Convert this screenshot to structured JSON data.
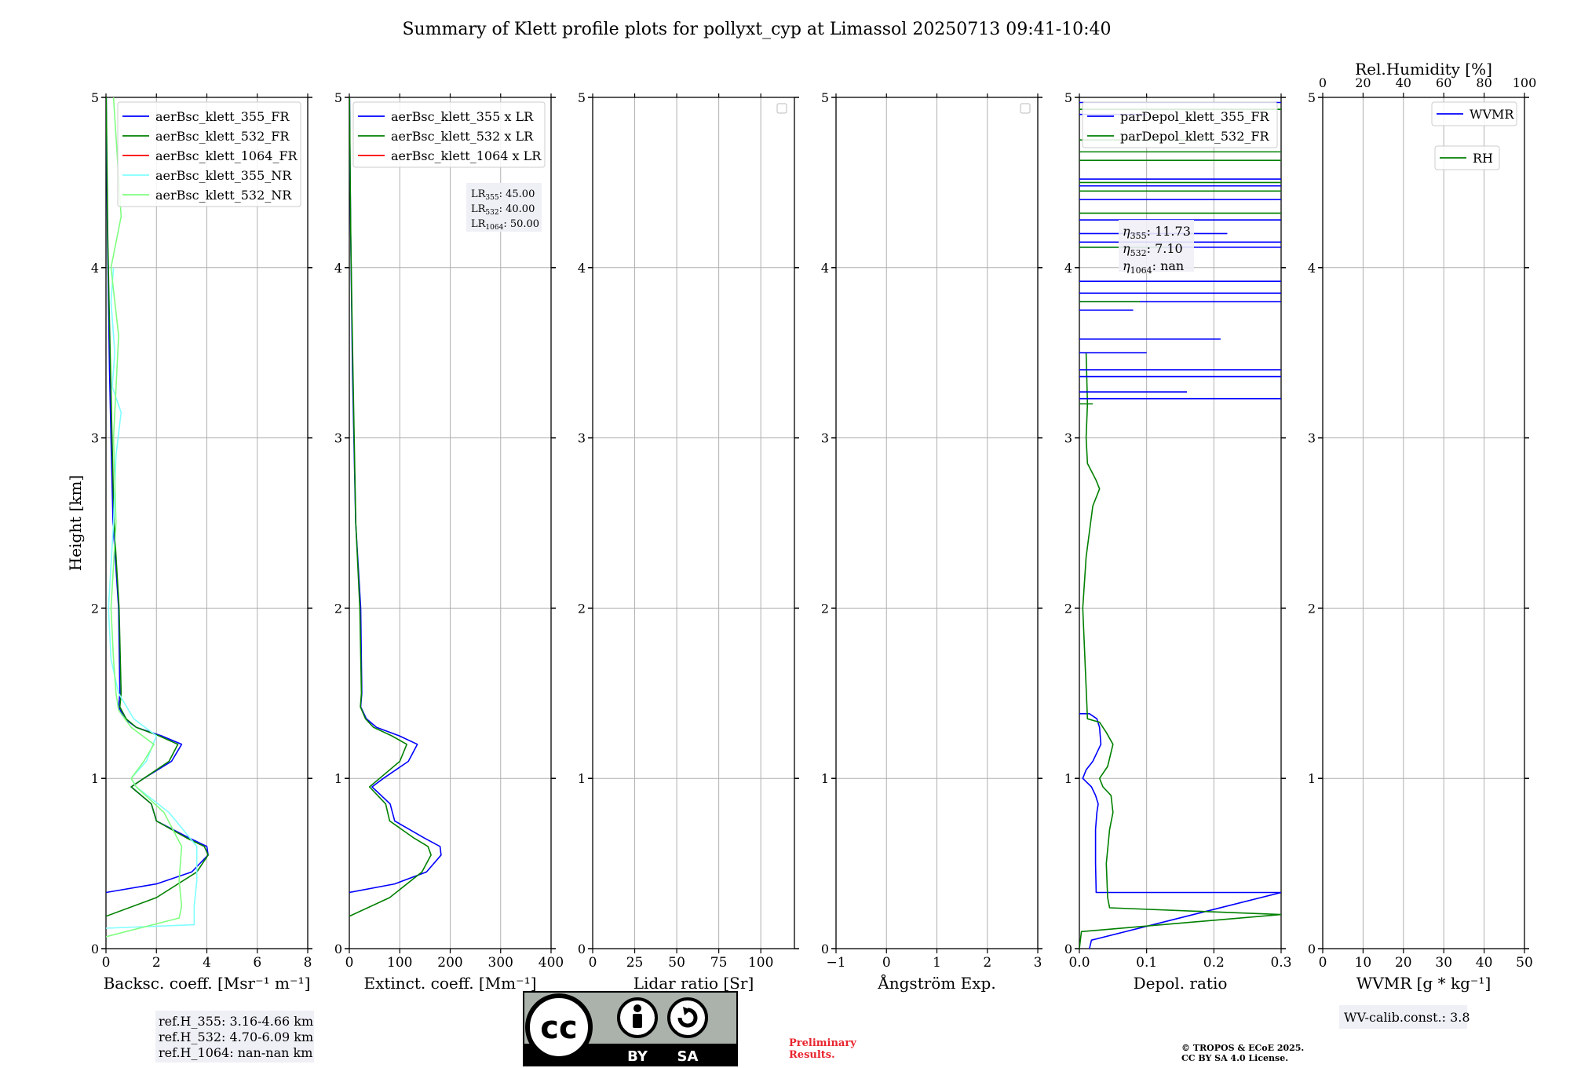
{
  "title": "Summary of Klett profile plots for pollyxt_cyp at Limassol 20250713 09:41-10:40",
  "colors": {
    "blue": "#0000ff",
    "green": "#008000",
    "red": "#ff0000",
    "cyan": "#80ffff",
    "light_green": "#80ff80",
    "grid": "#b0b0b0",
    "box_bg": "#eff0f6"
  },
  "chart_data": [
    {
      "id": "backscatter",
      "type": "line",
      "xlabel": "Backsc. coeff. [Msr⁻¹ m⁻¹]",
      "ylabel": "Height [km]",
      "xlim": [
        0,
        8
      ],
      "ylim": [
        0,
        5
      ],
      "xticks": [
        "0",
        "2",
        "4",
        "6",
        "8"
      ],
      "yticks": [
        "0",
        "1",
        "2",
        "3",
        "4",
        "5"
      ],
      "grid": true,
      "legend_position": "top-right",
      "series": [
        {
          "name": "aerBsc_klett_355_FR",
          "color": "#0000ff",
          "x": [
            0.01,
            0.03,
            0.06,
            0.1,
            0.14,
            0.2,
            0.28,
            0.5,
            0.55,
            0.5,
            0.75,
            1.2,
            2.2,
            3.0,
            2.6,
            1.5,
            1.0,
            1.8,
            2.0,
            3.3,
            4.0,
            4.05,
            3.4,
            2.0,
            0.0
          ],
          "y": [
            5.0,
            4.6,
            4.2,
            3.8,
            3.4,
            3.0,
            2.5,
            2.0,
            1.5,
            1.42,
            1.35,
            1.3,
            1.25,
            1.2,
            1.1,
            1.0,
            0.95,
            0.85,
            0.75,
            0.65,
            0.6,
            0.55,
            0.45,
            0.38,
            0.33
          ]
        },
        {
          "name": "aerBsc_klett_532_FR",
          "color": "#008000",
          "x": [
            0.01,
            0.04,
            0.07,
            0.12,
            0.18,
            0.24,
            0.32,
            0.52,
            0.6,
            0.55,
            0.8,
            1.2,
            2.1,
            2.85,
            2.5,
            1.5,
            1.0,
            1.8,
            2.0,
            3.2,
            3.9,
            4.05,
            3.6,
            2.0,
            0.0
          ],
          "y": [
            5.0,
            4.6,
            4.2,
            3.8,
            3.4,
            3.0,
            2.5,
            2.0,
            1.5,
            1.42,
            1.35,
            1.3,
            1.25,
            1.2,
            1.1,
            1.0,
            0.95,
            0.85,
            0.75,
            0.65,
            0.6,
            0.55,
            0.45,
            0.3,
            0.19
          ]
        },
        {
          "name": "aerBsc_klett_1064_FR",
          "color": "#ff0000",
          "x": [],
          "y": []
        },
        {
          "name": "aerBsc_klett_355_NR",
          "color": "#80ffff",
          "x": [
            0.3,
            0.2,
            0.35,
            0.25,
            0.6,
            0.4,
            0.3,
            0.1,
            0.2,
            0.5,
            1.1,
            2.0,
            1.6,
            1.0,
            1.2,
            2.5,
            3.6,
            3.6,
            3.5,
            3.5,
            0.0
          ],
          "y": [
            4.0,
            3.8,
            3.5,
            3.3,
            3.15,
            2.9,
            2.5,
            2.0,
            1.7,
            1.5,
            1.35,
            1.25,
            1.1,
            1.0,
            0.95,
            0.8,
            0.6,
            0.4,
            0.25,
            0.14,
            0.12
          ]
        },
        {
          "name": "aerBsc_klett_532_NR",
          "color": "#80ff80",
          "x": [
            0.3,
            0.6,
            0.2,
            0.5,
            0.3,
            0.4,
            0.2,
            0.3,
            0.4,
            0.5,
            1.0,
            1.9,
            1.5,
            1.0,
            1.2,
            2.3,
            3.0,
            2.9,
            3.0,
            2.9,
            0.0
          ],
          "y": [
            5.0,
            4.3,
            4.0,
            3.6,
            3.0,
            2.5,
            2.0,
            1.7,
            1.5,
            1.4,
            1.3,
            1.2,
            1.1,
            1.0,
            0.95,
            0.8,
            0.6,
            0.4,
            0.25,
            0.18,
            0.07
          ]
        }
      ],
      "annotation": [
        "ref.H_355: 3.16-4.66 km",
        "ref.H_532: 4.70-6.09 km",
        "ref.H_1064: nan-nan km"
      ]
    },
    {
      "id": "extinction",
      "type": "line",
      "xlabel": "Extinct. coeff. [Mm⁻¹]",
      "xlim": [
        0,
        400
      ],
      "ylim": [
        0,
        5
      ],
      "xticks": [
        "0",
        "100",
        "200",
        "300",
        "400"
      ],
      "yticks": [
        "0",
        "1",
        "2",
        "3",
        "4",
        "5"
      ],
      "grid": true,
      "legend_position": "top-right",
      "series": [
        {
          "name": "aerBsc_klett_355 x LR",
          "color": "#0000ff",
          "x": [
            0.5,
            1.4,
            2.7,
            4.5,
            6.3,
            9,
            12.6,
            22.5,
            24.8,
            22.5,
            33.8,
            54,
            99,
            135,
            117,
            67.5,
            45,
            81,
            90,
            148.5,
            180,
            182,
            153,
            90,
            0
          ],
          "y": [
            5.0,
            4.6,
            4.2,
            3.8,
            3.4,
            3.0,
            2.5,
            2.0,
            1.5,
            1.42,
            1.35,
            1.3,
            1.25,
            1.2,
            1.1,
            1.0,
            0.95,
            0.85,
            0.75,
            0.65,
            0.6,
            0.55,
            0.45,
            0.38,
            0.33
          ]
        },
        {
          "name": "aerBsc_klett_532 x LR",
          "color": "#008000",
          "x": [
            0.4,
            1.6,
            2.8,
            4.8,
            7.2,
            9.6,
            12.8,
            20.8,
            24,
            22,
            32,
            48,
            84,
            114,
            100,
            60,
            40,
            72,
            80,
            128,
            156,
            162,
            144,
            80,
            0
          ],
          "y": [
            5.0,
            4.6,
            4.2,
            3.8,
            3.4,
            3.0,
            2.5,
            2.0,
            1.5,
            1.42,
            1.35,
            1.3,
            1.25,
            1.2,
            1.1,
            1.0,
            0.95,
            0.85,
            0.75,
            0.65,
            0.6,
            0.55,
            0.45,
            0.3,
            0.19
          ]
        },
        {
          "name": "aerBsc_klett_1064 x LR",
          "color": "#ff0000",
          "x": [],
          "y": []
        }
      ],
      "annotation": [
        {
          "label": "LR",
          "sub": "355",
          "value": ": 45.00"
        },
        {
          "label": "LR",
          "sub": "532",
          "value": ": 40.00"
        },
        {
          "label": "LR",
          "sub": "1064",
          "value": ": 50.00"
        }
      ]
    },
    {
      "id": "lidar_ratio",
      "type": "line",
      "xlabel": "Lidar ratio [Sr]",
      "xlim": [
        0,
        120
      ],
      "ylim": [
        0,
        5
      ],
      "xticks": [
        "0",
        "25",
        "50",
        "75",
        "100"
      ],
      "yticks": [
        "0",
        "1",
        "2",
        "3",
        "4",
        "5"
      ],
      "grid": true,
      "legend_position": "top-right",
      "series": []
    },
    {
      "id": "angstrom",
      "type": "line",
      "xlabel": "Ångström Exp.",
      "xlim": [
        -1,
        3
      ],
      "ylim": [
        0,
        5
      ],
      "xticks": [
        "−1",
        "0",
        "1",
        "2",
        "3"
      ],
      "yticks": [
        "0",
        "1",
        "2",
        "3",
        "4",
        "5"
      ],
      "grid": true,
      "legend_position": "top-right",
      "series": []
    },
    {
      "id": "depol",
      "type": "line",
      "xlabel": "Depol. ratio",
      "xlim": [
        0,
        0.3
      ],
      "ylim": [
        0,
        5
      ],
      "xticks": [
        "0.0",
        "0.1",
        "0.2",
        "0.3"
      ],
      "yticks": [
        "0",
        "1",
        "2",
        "3",
        "4",
        "5"
      ],
      "grid": true,
      "legend_position": "top-left",
      "series": [
        {
          "name": "parDepol_klett_355_FR",
          "color": "#0000ff",
          "x": [
            0.015,
            0.018,
            0.3,
            0.025,
            0.024,
            0.024,
            0.026,
            0.028,
            0.024,
            0.018,
            0.005,
            0.01,
            0.02,
            0.032,
            0.03,
            0.026,
            0.015,
            0.003,
            0.0
          ],
          "y": [
            0.0,
            0.05,
            0.33,
            0.33,
            0.5,
            0.7,
            0.8,
            0.85,
            0.9,
            0.95,
            1.0,
            1.05,
            1.1,
            1.2,
            1.3,
            1.35,
            1.38,
            1.38,
            1.38
          ]
        },
        {
          "name": "parDepol_klett_532_FR",
          "color": "#008000",
          "x": [
            0.0,
            0.003,
            0.3,
            0.045,
            0.042,
            0.04,
            0.045,
            0.05,
            0.047,
            0.035,
            0.03,
            0.042,
            0.05,
            0.04,
            0.035,
            0.03,
            0.012,
            0.005,
            0.01,
            0.02,
            0.03,
            0.025,
            0.012,
            0.01,
            0.012,
            0.01
          ],
          "y": [
            0.0,
            0.1,
            0.2,
            0.24,
            0.3,
            0.5,
            0.7,
            0.8,
            0.9,
            0.95,
            1.0,
            1.07,
            1.2,
            1.27,
            1.3,
            1.33,
            1.35,
            2.0,
            2.3,
            2.6,
            2.7,
            2.75,
            2.85,
            3.0,
            3.2,
            3.5
          ]
        }
      ],
      "spikes_355": [
        {
          "y": 3.23,
          "x": 0.3
        },
        {
          "y": 3.27,
          "x": 0.16
        },
        {
          "y": 3.36,
          "x": 0.3
        },
        {
          "y": 3.4,
          "x": 0.3
        },
        {
          "y": 3.5,
          "x": 0.1
        },
        {
          "y": 3.58,
          "x": 0.21
        },
        {
          "y": 3.75,
          "x": 0.08
        },
        {
          "y": 3.8,
          "x": 0.3
        },
        {
          "y": 3.85,
          "x": 0.3
        },
        {
          "y": 3.92,
          "x": 0.3
        },
        {
          "y": 4.12,
          "x": 0.3
        },
        {
          "y": 4.15,
          "x": 0.3
        },
        {
          "y": 4.2,
          "x": 0.22
        },
        {
          "y": 4.28,
          "x": 0.3
        },
        {
          "y": 4.4,
          "x": 0.3
        },
        {
          "y": 4.45,
          "x": 0.3
        },
        {
          "y": 4.48,
          "x": 0.3
        },
        {
          "y": 4.52,
          "x": 0.3
        },
        {
          "y": 4.9,
          "x": 0.1
        },
        {
          "y": 4.97,
          "x": 0.3
        }
      ],
      "spikes_532": [
        {
          "y": 3.2,
          "x": 0.02
        },
        {
          "y": 3.8,
          "x": 0.09
        },
        {
          "y": 4.12,
          "x": 0.13
        },
        {
          "y": 4.32,
          "x": 0.3
        },
        {
          "y": 4.45,
          "x": 0.3
        },
        {
          "y": 4.5,
          "x": 0.3
        },
        {
          "y": 4.63,
          "x": 0.3
        },
        {
          "y": 4.68,
          "x": 0.3
        },
        {
          "y": 4.75,
          "x": 0.2
        },
        {
          "y": 4.93,
          "x": 0.3
        }
      ],
      "annotation": [
        {
          "label": "η",
          "sub": "355",
          "value": ": 11.73"
        },
        {
          "label": "η",
          "sub": "532",
          "value": ": 7.10"
        },
        {
          "label": "η",
          "sub": "1064",
          "value": ": nan"
        }
      ]
    },
    {
      "id": "wvmr",
      "type": "line",
      "xlabel": "WVMR [g * kg⁻¹]",
      "top_xlabel": "Rel.Humidity [%]",
      "xlim": [
        0,
        50
      ],
      "top_xlim": [
        0,
        100
      ],
      "ylim": [
        0,
        5
      ],
      "xticks": [
        "0",
        "10",
        "20",
        "30",
        "40",
        "50"
      ],
      "top_xticks": [
        "0",
        "20",
        "40",
        "60",
        "80",
        "100"
      ],
      "yticks": [
        "0",
        "1",
        "2",
        "3",
        "4",
        "5"
      ],
      "grid": true,
      "legend_position": "top-right",
      "series": [
        {
          "name": "WVMR",
          "color": "#0000ff",
          "x": [],
          "y": []
        },
        {
          "name": "RH",
          "color": "#008000",
          "x": [],
          "y": []
        }
      ],
      "annotation": [
        "WV-calib.const.: 3.8"
      ]
    }
  ],
  "footer": {
    "cc_text_by": "BY",
    "cc_text_sa": "SA",
    "cc_logo_text": "cc",
    "preliminary_line1": "Preliminary",
    "preliminary_line2": "Results.",
    "copyright_line1": "© TROPOS & ECoE 2025.",
    "copyright_line2": "CC BY SA 4.0 License."
  }
}
